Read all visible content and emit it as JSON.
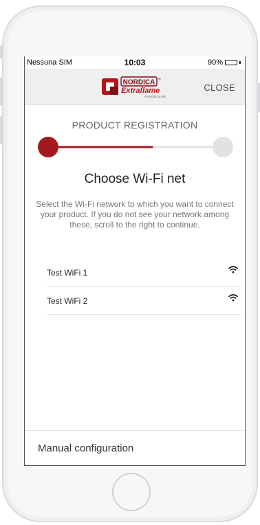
{
  "status_bar": {
    "carrier": "Nessuna SIM",
    "time": "10:03",
    "battery": "90%",
    "battery_level": 0.9
  },
  "header": {
    "brand_top": "NORDICA",
    "brand_bottom": "Extraflame",
    "tagline": "Riscalda la vita.",
    "close_label": "CLOSE"
  },
  "registration": {
    "title": "PRODUCT REGISTRATION",
    "progress_fraction": 0.6
  },
  "main": {
    "title": "Choose Wi-Fi net",
    "description": "Select the Wi-Fi network to which you want to connect your product. If you do not see your network among these, scroll to the right to continue."
  },
  "networks": [
    {
      "name": "Test WiFi 1",
      "icon": "wifi-icon"
    },
    {
      "name": "Test WiFi 2",
      "icon": "wifi-icon"
    }
  ],
  "footer": {
    "manual_label": "Manual configuration"
  },
  "colors": {
    "accent": "#a3191f",
    "track": "#e2e2e2"
  }
}
